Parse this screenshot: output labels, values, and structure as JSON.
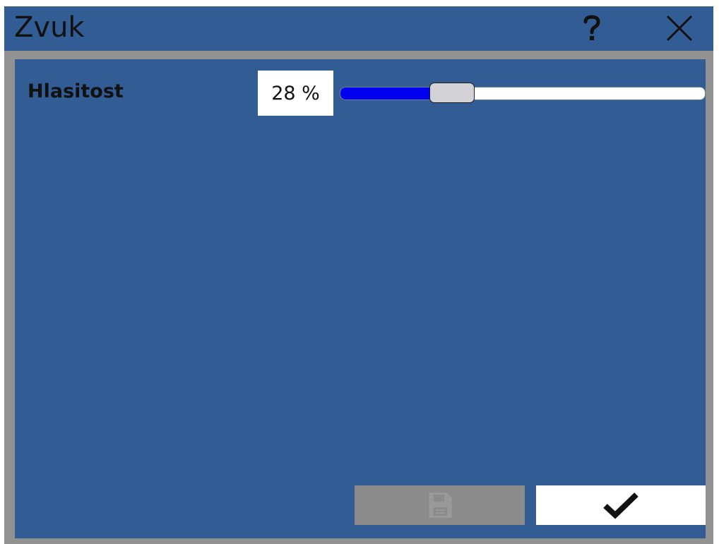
{
  "window": {
    "title": "Zvuk",
    "icons": {
      "help": "question-mark-icon",
      "close": "close-icon"
    }
  },
  "settings": {
    "volume": {
      "label": "Hlasitost",
      "value_text": "28 %",
      "value_percent": 28
    }
  },
  "actions": {
    "save": {
      "icon": "save-icon",
      "enabled": false
    },
    "confirm": {
      "icon": "checkmark-icon",
      "enabled": true
    }
  },
  "colors": {
    "panel": "#325c94",
    "frame": "#929292",
    "slider_fill": "#0000ee",
    "slider_thumb": "#d2d2d6",
    "disabled_button": "#8b8b8b"
  }
}
